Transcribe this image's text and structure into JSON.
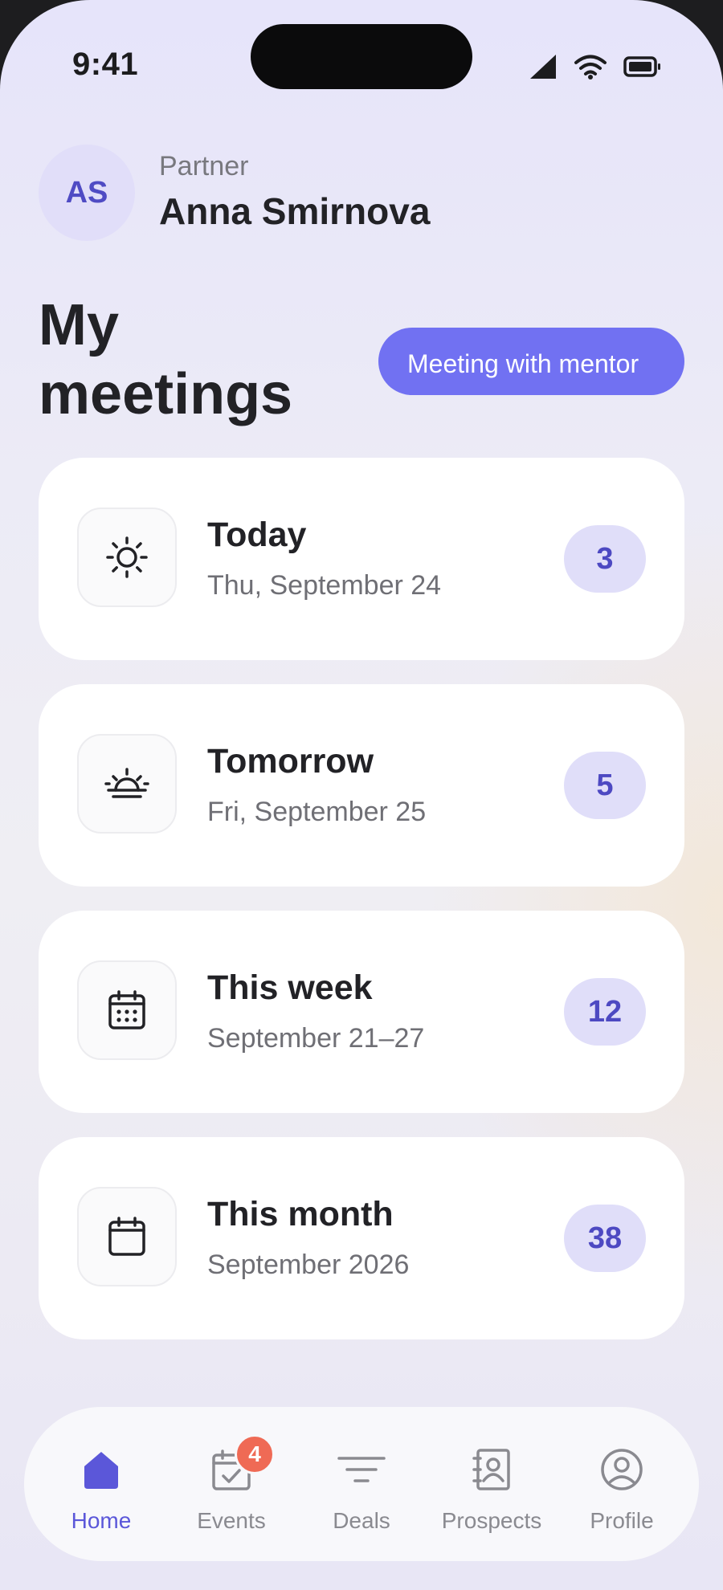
{
  "status_bar": {
    "time": "9:41"
  },
  "user": {
    "initials": "AS",
    "role": "Partner",
    "name": "Anna Smirnova"
  },
  "page": {
    "title": "My meetings",
    "action_label": "Meeting with mentor"
  },
  "colors": {
    "accent": "#7171f2",
    "badge_bg": "#e0def9",
    "badge_text": "#4d49c2",
    "notification": "#ef6a55"
  },
  "meetings": [
    {
      "icon": "sun-icon",
      "title": "Today",
      "subtitle": "Thu, September 24",
      "count": "3"
    },
    {
      "icon": "sunrise-icon",
      "title": "Tomorrow",
      "subtitle": "Fri, September 25",
      "count": "5"
    },
    {
      "icon": "calendar-week-icon",
      "title": "This week",
      "subtitle": "September 21–27",
      "count": "12"
    },
    {
      "icon": "calendar-month-icon",
      "title": "This month",
      "subtitle": "September 2026",
      "count": "38"
    }
  ],
  "tabs": [
    {
      "icon": "home-icon",
      "label": "Home",
      "active": true
    },
    {
      "icon": "events-icon",
      "label": "Events",
      "badge": "4"
    },
    {
      "icon": "filter-icon",
      "label": "Deals"
    },
    {
      "icon": "contacts-book-icon",
      "label": "Prospects"
    },
    {
      "icon": "profile-icon",
      "label": "Profile"
    }
  ]
}
